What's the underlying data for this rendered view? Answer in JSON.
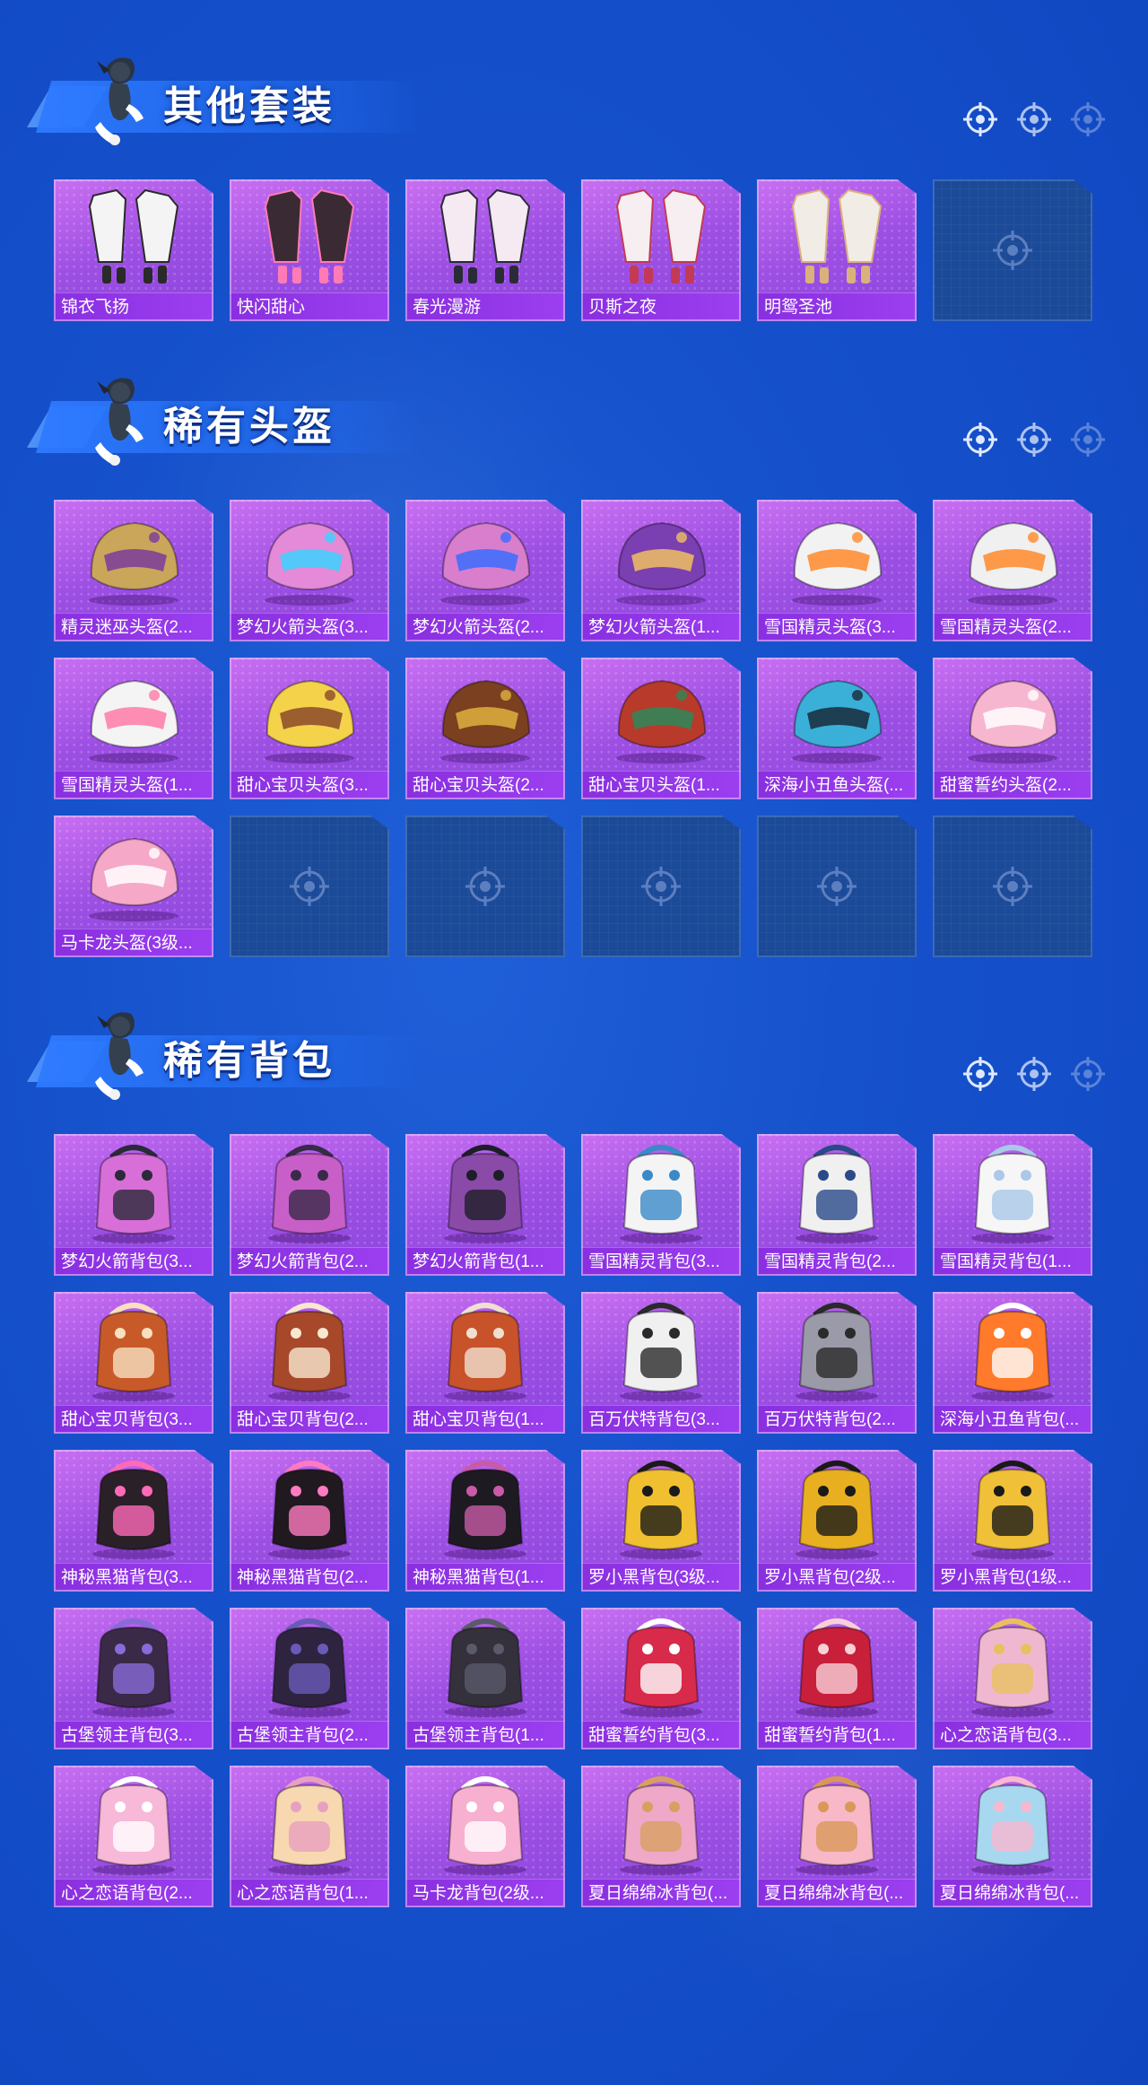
{
  "colors": {
    "background": "#1652cc",
    "card_purple": "#9d4fe3",
    "label_bar": "#8a2fe0",
    "empty_slot": "#1b4a98",
    "title_text": "#ffffff"
  },
  "sections": [
    {
      "title": "其他套装",
      "items": [
        {
          "label": "锦衣飞扬",
          "icon": "outfit-icon",
          "tint": "#f4f4f4",
          "accent": "#2a2a2a"
        },
        {
          "label": "快闪甜心",
          "icon": "outfit-icon",
          "tint": "#3a2a33",
          "accent": "#ff7bb5"
        },
        {
          "label": "春光漫游",
          "icon": "outfit-icon",
          "tint": "#f5e9f2",
          "accent": "#2b2b38"
        },
        {
          "label": "贝斯之夜",
          "icon": "outfit-icon",
          "tint": "#f6eef0",
          "accent": "#c23a55"
        },
        {
          "label": "明鸳圣池",
          "icon": "outfit-icon",
          "tint": "#f2ece6",
          "accent": "#d8b27a"
        },
        {
          "label": "",
          "empty": true
        }
      ]
    },
    {
      "title": "稀有头盔",
      "items": [
        {
          "label": "精灵迷巫头盔(2...",
          "icon": "helmet-icon",
          "tint": "#c9a65a",
          "accent": "#7a3b9a"
        },
        {
          "label": "梦幻火箭头盔(3...",
          "icon": "helmet-icon",
          "tint": "#e48ad8",
          "accent": "#3ad2ff"
        },
        {
          "label": "梦幻火箭头盔(2...",
          "icon": "helmet-icon",
          "tint": "#d97ecd",
          "accent": "#3a6cff"
        },
        {
          "label": "梦幻火箭头盔(1...",
          "icon": "helmet-icon",
          "tint": "#7a3fb0",
          "accent": "#f0c060"
        },
        {
          "label": "雪国精灵头盔(3...",
          "icon": "helmet-icon",
          "tint": "#f2f2f2",
          "accent": "#ff8a2a"
        },
        {
          "label": "雪国精灵头盔(2...",
          "icon": "helmet-icon",
          "tint": "#f0f0f0",
          "accent": "#ff8a2a"
        },
        {
          "label": "雪国精灵头盔(1...",
          "icon": "helmet-icon",
          "tint": "#f4f4f4",
          "accent": "#ff7aa8"
        },
        {
          "label": "甜心宝贝头盔(3...",
          "icon": "helmet-icon",
          "tint": "#f4d24a",
          "accent": "#8a4a2a"
        },
        {
          "label": "甜心宝贝头盔(2...",
          "icon": "helmet-icon",
          "tint": "#7a4020",
          "accent": "#e0b040"
        },
        {
          "label": "甜心宝贝头盔(1...",
          "icon": "helmet-icon",
          "tint": "#b83a2a",
          "accent": "#2a8a5a"
        },
        {
          "label": "深海小丑鱼头盔(...",
          "icon": "helmet-icon",
          "tint": "#3ab0d8",
          "accent": "#1a2a3a"
        },
        {
          "label": "甜蜜誓约头盔(2...",
          "icon": "helmet-icon",
          "tint": "#f7b6cf",
          "accent": "#ffffff"
        },
        {
          "label": "马卡龙头盔(3级...",
          "icon": "helmet-icon",
          "tint": "#f6a8c8",
          "accent": "#ffffff"
        },
        {
          "label": "",
          "empty": true
        },
        {
          "label": "",
          "empty": true
        },
        {
          "label": "",
          "empty": true
        },
        {
          "label": "",
          "empty": true
        },
        {
          "label": "",
          "empty": true
        }
      ]
    },
    {
      "title": "稀有背包",
      "items": [
        {
          "label": "梦幻火箭背包(3...",
          "icon": "backpack-icon",
          "tint": "#d86fd8",
          "accent": "#2a2a3a"
        },
        {
          "label": "梦幻火箭背包(2...",
          "icon": "backpack-icon",
          "tint": "#c85fc8",
          "accent": "#3a2a4a"
        },
        {
          "label": "梦幻火箭背包(1...",
          "icon": "backpack-icon",
          "tint": "#8a4aa8",
          "accent": "#1e1e28"
        },
        {
          "label": "雪国精灵背包(3...",
          "icon": "backpack-icon",
          "tint": "#f4f4f4",
          "accent": "#3a8ac8"
        },
        {
          "label": "雪国精灵背包(2...",
          "icon": "backpack-icon",
          "tint": "#f0f0f0",
          "accent": "#2a4a8a"
        },
        {
          "label": "雪国精灵背包(1...",
          "icon": "backpack-icon",
          "tint": "#f6f6f6",
          "accent": "#aac8e8"
        },
        {
          "label": "甜心宝贝背包(3...",
          "icon": "backpack-icon",
          "tint": "#c85a2a",
          "accent": "#f8e0c0"
        },
        {
          "label": "甜心宝贝背包(2...",
          "icon": "backpack-icon",
          "tint": "#a8482a",
          "accent": "#f8e8d0"
        },
        {
          "label": "甜心宝贝背包(1...",
          "icon": "backpack-icon",
          "tint": "#c8522a",
          "accent": "#f0e0d0"
        },
        {
          "label": "百万伏特背包(3...",
          "icon": "backpack-icon",
          "tint": "#f0f0f0",
          "accent": "#2a2a2a"
        },
        {
          "label": "百万伏特背包(2...",
          "icon": "backpack-icon",
          "tint": "#9a9aa8",
          "accent": "#2a2a2a"
        },
        {
          "label": "深海小丑鱼背包(...",
          "icon": "backpack-icon",
          "tint": "#ff7a2a",
          "accent": "#ffffff"
        },
        {
          "label": "神秘黑猫背包(3...",
          "icon": "backpack-icon",
          "tint": "#2a2028",
          "accent": "#ff6ab8"
        },
        {
          "label": "神秘黑猫背包(2...",
          "icon": "backpack-icon",
          "tint": "#201a20",
          "accent": "#ff7ac0"
        },
        {
          "label": "神秘黑猫背包(1...",
          "icon": "backpack-icon",
          "tint": "#1e1a22",
          "accent": "#c85aa8"
        },
        {
          "label": "罗小黑背包(3级...",
          "icon": "backpack-icon",
          "tint": "#f0c030",
          "accent": "#1a1a1a"
        },
        {
          "label": "罗小黑背包(2级...",
          "icon": "backpack-icon",
          "tint": "#e8b020",
          "accent": "#1a1a1a"
        },
        {
          "label": "罗小黑背包(1级...",
          "icon": "backpack-icon",
          "tint": "#f0c038",
          "accent": "#1a1a1a"
        },
        {
          "label": "古堡领主背包(3...",
          "icon": "backpack-icon",
          "tint": "#3a2a48",
          "accent": "#8a6ad8"
        },
        {
          "label": "古堡领主背包(2...",
          "icon": "backpack-icon",
          "tint": "#2e2440",
          "accent": "#6a5ab8"
        },
        {
          "label": "古堡领主背包(1...",
          "icon": "backpack-icon",
          "tint": "#34303c",
          "accent": "#5a5a6a"
        },
        {
          "label": "甜蜜誓约背包(3...",
          "icon": "backpack-icon",
          "tint": "#d82a4a",
          "accent": "#ffffff"
        },
        {
          "label": "甜蜜誓约背包(1...",
          "icon": "backpack-icon",
          "tint": "#c8203a",
          "accent": "#f8d0d8"
        },
        {
          "label": "心之恋语背包(3...",
          "icon": "backpack-icon",
          "tint": "#f0b8d0",
          "accent": "#e8c060"
        },
        {
          "label": "心之恋语背包(2...",
          "icon": "backpack-icon",
          "tint": "#f8b8d8",
          "accent": "#ffffff"
        },
        {
          "label": "心之恋语背包(1...",
          "icon": "backpack-icon",
          "tint": "#f8d8b0",
          "accent": "#e8a0c0"
        },
        {
          "label": "马卡龙背包(2级...",
          "icon": "backpack-icon",
          "tint": "#f8b0d0",
          "accent": "#ffffff"
        },
        {
          "label": "夏日绵绵冰背包(...",
          "icon": "backpack-icon",
          "tint": "#f0a8c8",
          "accent": "#d8a060"
        },
        {
          "label": "夏日绵绵冰背包(...",
          "icon": "backpack-icon",
          "tint": "#f8b8c8",
          "accent": "#d89858"
        },
        {
          "label": "夏日绵绵冰背包(...",
          "icon": "backpack-icon",
          "tint": "#a8d8f0",
          "accent": "#f8b8d0"
        }
      ]
    }
  ]
}
